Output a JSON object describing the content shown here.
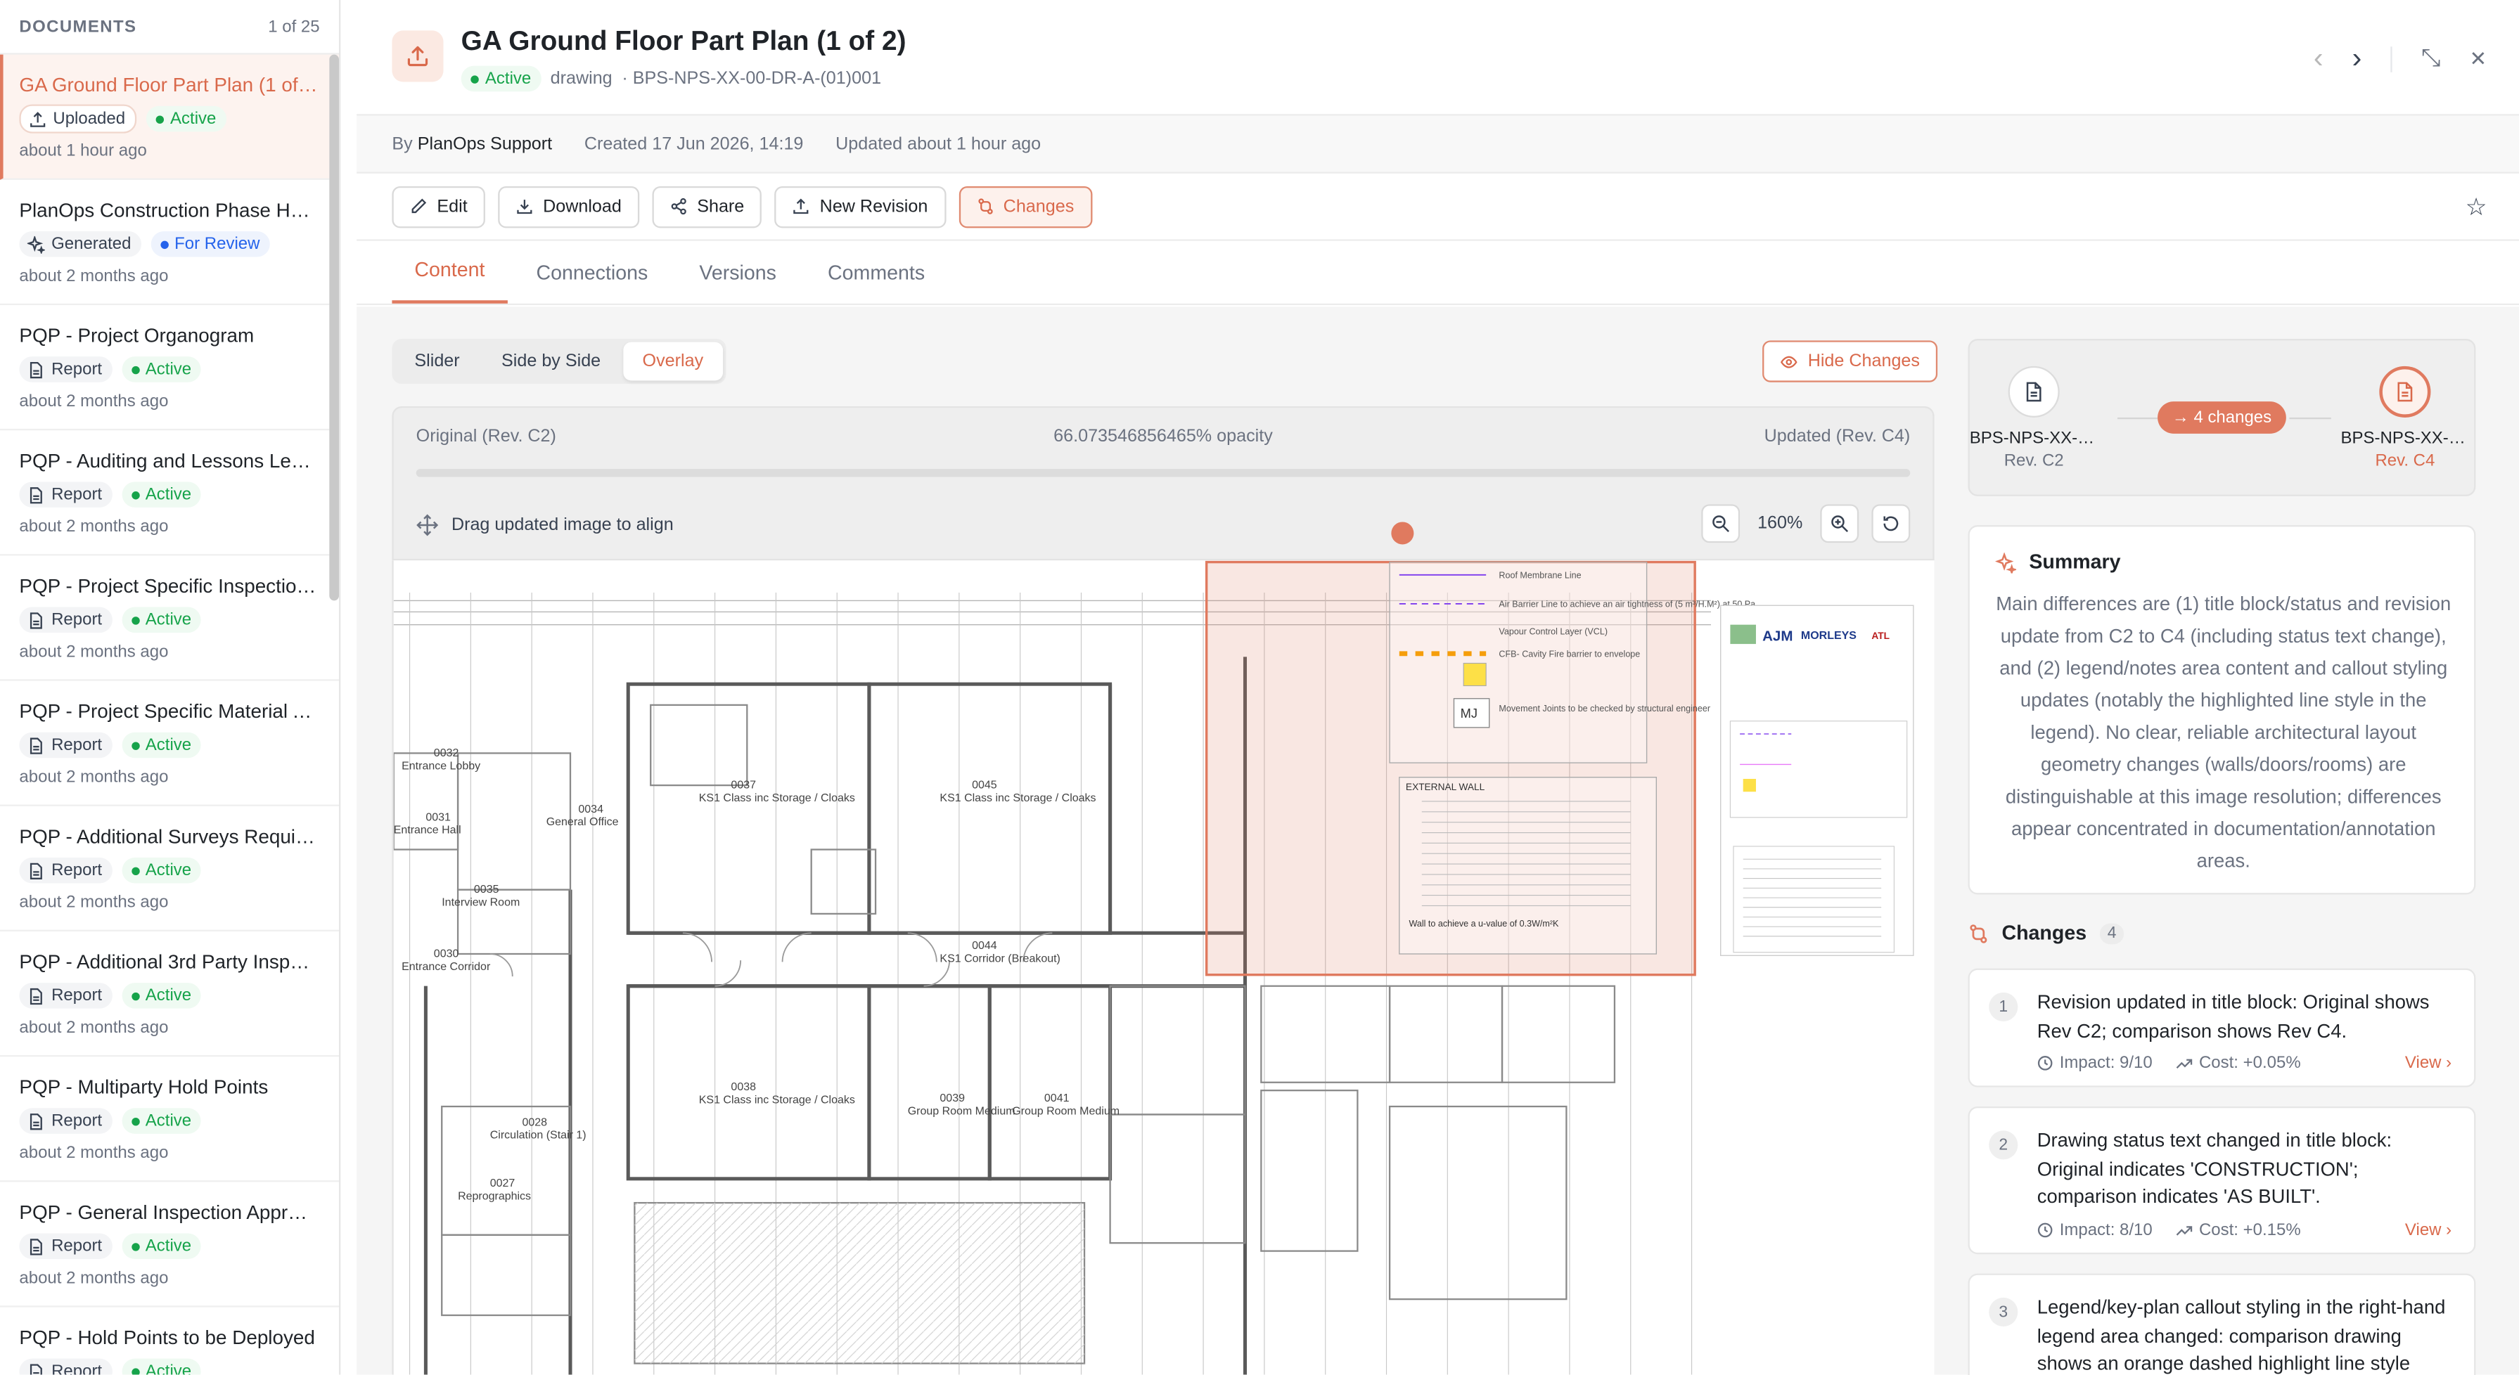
{
  "sidebar": {
    "title": "DOCUMENTS",
    "count": "1 of 25",
    "items": [
      {
        "name": "GA Ground Floor Part Plan (1 of 2)",
        "type": "Uploaded",
        "type_icon": "upload-icon",
        "status": "Active",
        "time": "about 1 hour ago"
      },
      {
        "name": "PlanOps Construction Phase Health and Safety Plan",
        "type": "Generated",
        "type_icon": "sparkle-icon",
        "status": "For Review",
        "time": "about 2 months ago"
      },
      {
        "name": "PQP - Project Organogram",
        "type": "Report",
        "type_icon": "document-icon",
        "status": "Active",
        "time": "about 2 months ago"
      },
      {
        "name": "PQP - Auditing and Lessons Learned",
        "type": "Report",
        "type_icon": "document-icon",
        "status": "Active",
        "time": "about 2 months ago"
      },
      {
        "name": "PQP - Project Specific Inspection and Test Plans",
        "type": "Report",
        "type_icon": "document-icon",
        "status": "Active",
        "time": "about 2 months ago"
      },
      {
        "name": "PQP - Project Specific Material Approvals",
        "type": "Report",
        "type_icon": "document-icon",
        "status": "Active",
        "time": "about 2 months ago"
      },
      {
        "name": "PQP - Additional Surveys Required",
        "type": "Report",
        "type_icon": "document-icon",
        "status": "Active",
        "time": "about 2 months ago"
      },
      {
        "name": "PQP - Additional 3rd Party Inspections",
        "type": "Report",
        "type_icon": "document-icon",
        "status": "Active",
        "time": "about 2 months ago"
      },
      {
        "name": "PQP - Multiparty Hold Points",
        "type": "Report",
        "type_icon": "document-icon",
        "status": "Active",
        "time": "about 2 months ago"
      },
      {
        "name": "PQP - General Inspection Approach",
        "type": "Report",
        "type_icon": "document-icon",
        "status": "Active",
        "time": "about 2 months ago"
      },
      {
        "name": "PQP - Hold Points to be Deployed",
        "type": "Report",
        "type_icon": "document-icon",
        "status": "Active",
        "time": ""
      }
    ]
  },
  "header": {
    "title": "GA Ground Floor Part Plan (1 of 2)",
    "status": "Active",
    "kind": "drawing",
    "ref": "· BPS-NPS-XX-00-DR-A-(01)001",
    "nav": {
      "prev": "‹",
      "next": "›",
      "collapse": "⤡",
      "close": "✕"
    }
  },
  "byline": {
    "by_label": "By",
    "author": "PlanOps Support",
    "created": "Created 17 Jun 2026, 14:19",
    "updated": "Updated about 1 hour ago"
  },
  "toolbar": {
    "edit": "Edit",
    "download": "Download",
    "share": "Share",
    "new_revision": "New Revision",
    "changes": "Changes"
  },
  "tabs": [
    "Content",
    "Connections",
    "Versions",
    "Comments"
  ],
  "viewer": {
    "modes": [
      "Slider",
      "Side by Side",
      "Overlay"
    ],
    "hide_changes": "Hide Changes",
    "original_label": "Original (Rev. C2)",
    "opacity_label": "66.073546856465% opacity",
    "updated_label": "Updated (Rev. C4)",
    "opacity": 0.66073546856465,
    "drag_label": "Drag updated image to align",
    "zoom": "160%"
  },
  "drawing": {
    "rooms": [
      "KS1 Class inc Storage / Cloaks",
      "KS1 Class inc Storage / Cloaks",
      "KS1 Corridor (Breakout)",
      "KS1 Class inc Storage / Cloaks",
      "Group Room Medium",
      "Group Room Medium",
      "General Office",
      "Interview Room",
      "Entrance Corridor",
      "Circulation (Stair 1)",
      "Reprographics",
      "Entrance Hall",
      "Entrance Lobby"
    ],
    "room_numbers": [
      "0037",
      "0045",
      "0044",
      "0038",
      "0039",
      "0041",
      "0034",
      "0035",
      "0030",
      "0028",
      "0027",
      "0031",
      "0032"
    ],
    "legend": [
      "Roof Membrane Line",
      "Air Barrier Line to achieve an air tightness of (5 m³/H.M²) at 50 Pa",
      "Vapour Control Layer (VCL)",
      "CFB- Cavity Fire barrier to envelope",
      "Movement Joints to be checked by structural engineer",
      "EXTERNAL WALL"
    ],
    "mj": "MJ",
    "logos": [
      "AJM",
      "MORLEYS",
      "ATL"
    ],
    "wall_note": "Wall to achieve a u-value of 0.3W/m²K"
  },
  "revisions": {
    "left_name": "BPS-NPS-XX-00-DR-A-(01)001",
    "left_rev": "Rev. C2",
    "right_name": "BPS-NPS-XX-00-DR-A-(01)001",
    "right_rev": "Rev. C4",
    "changes_pill": "→ 4 changes"
  },
  "summary": {
    "title": "Summary",
    "text": "Main differences are (1) title block/status and revision update from C2 to C4 (including status text change), and (2) legend/notes area content and callout styling updates (notably the highlighted line style in the legend). No clear, reliable architectural layout geometry changes (walls/doors/rooms) are distinguishable at this image resolution; differences appear concentrated in documentation/annotation areas."
  },
  "changes": {
    "title": "Changes",
    "count": "4",
    "items": [
      {
        "num": "1",
        "text": "Revision updated in title block: Original shows Rev C2; comparison shows Rev C4.",
        "impact": "Impact: 9/10",
        "cost": "Cost: +0.05%",
        "view": "View ›"
      },
      {
        "num": "2",
        "text": "Drawing status text changed in title block: Original indicates 'CONSTRUCTION'; comparison indicates 'AS BUILT'.",
        "impact": "Impact: 8/10",
        "cost": "Cost: +0.15%",
        "view": "View ›"
      },
      {
        "num": "3",
        "text": "Legend/key-plan callout styling in the right-hand legend area changed: comparison drawing shows an orange dashed highlight line style",
        "impact": "",
        "cost": "",
        "view": ""
      }
    ]
  },
  "colors": {
    "accent": "#e07a5f",
    "active_green": "#16a34a",
    "review_blue": "#2563eb"
  }
}
